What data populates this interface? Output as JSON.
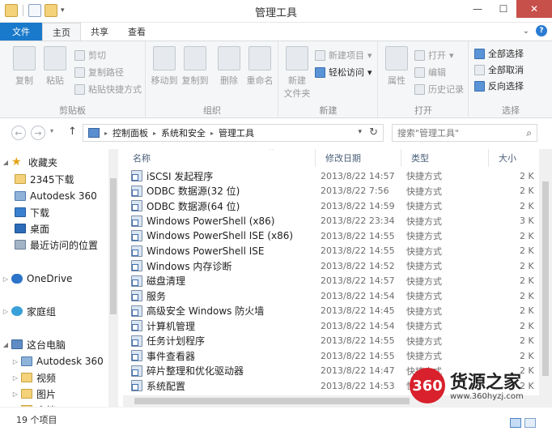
{
  "window": {
    "title": "管理工具",
    "controls": {
      "minimize": "—",
      "maximize": "☐",
      "close": "✕"
    }
  },
  "ribbon_tabs": [
    "文件",
    "主页",
    "共享",
    "查看"
  ],
  "ribbon": {
    "clipboard": {
      "copy": "复制",
      "paste": "粘贴",
      "cut": "剪切",
      "copy_path": "复制路径",
      "paste_shortcut": "粘贴快捷方式",
      "label": "剪贴板"
    },
    "organize": {
      "move_to": "移动到",
      "copy_to": "复制到",
      "delete": "删除",
      "rename": "重命名",
      "label": "组织"
    },
    "new": {
      "new_folder_line1": "新建",
      "new_folder_line2": "文件夹",
      "new_item": "新建项目",
      "easy_access": "轻松访问",
      "label": "新建"
    },
    "open": {
      "properties": "属性",
      "open": "打开",
      "edit": "编辑",
      "history": "历史记录",
      "label": "打开"
    },
    "select": {
      "select_all": "全部选择",
      "select_none": "全部取消",
      "invert": "反向选择",
      "label": "选择"
    }
  },
  "address": {
    "crumbs": [
      "控制面板",
      "系统和安全",
      "管理工具"
    ],
    "search_placeholder": "搜索\"管理工具\""
  },
  "nav": {
    "favorites": "收藏夹",
    "fav_items": [
      "2345下载",
      "Autodesk 360",
      "下载",
      "桌面",
      "最近访问的位置"
    ],
    "onedrive": "OneDrive",
    "homegroup": "家庭组",
    "thispc": "这台电脑",
    "pc_items": [
      "Autodesk 360",
      "视频",
      "图片",
      "文档"
    ]
  },
  "columns": {
    "name": "名称",
    "date": "修改日期",
    "type": "类型",
    "size": "大小"
  },
  "files": [
    {
      "name": "iSCSI 发起程序",
      "date": "2013/8/22 14:57",
      "type": "快捷方式",
      "size": "2 K"
    },
    {
      "name": "ODBC 数据源(32 位)",
      "date": "2013/8/22 7:56",
      "type": "快捷方式",
      "size": "2 K"
    },
    {
      "name": "ODBC 数据源(64 位)",
      "date": "2013/8/22 14:59",
      "type": "快捷方式",
      "size": "2 K"
    },
    {
      "name": "Windows PowerShell (x86)",
      "date": "2013/8/22 23:34",
      "type": "快捷方式",
      "size": "3 K"
    },
    {
      "name": "Windows PowerShell ISE (x86)",
      "date": "2013/8/22 14:55",
      "type": "快捷方式",
      "size": "2 K"
    },
    {
      "name": "Windows PowerShell ISE",
      "date": "2013/8/22 14:55",
      "type": "快捷方式",
      "size": "2 K"
    },
    {
      "name": "Windows 内存诊断",
      "date": "2013/8/22 14:52",
      "type": "快捷方式",
      "size": "2 K"
    },
    {
      "name": "磁盘清理",
      "date": "2013/8/22 14:57",
      "type": "快捷方式",
      "size": "2 K"
    },
    {
      "name": "服务",
      "date": "2013/8/22 14:54",
      "type": "快捷方式",
      "size": "2 K"
    },
    {
      "name": "高级安全 Windows 防火墙",
      "date": "2013/8/22 14:45",
      "type": "快捷方式",
      "size": "2 K"
    },
    {
      "name": "计算机管理",
      "date": "2013/8/22 14:54",
      "type": "快捷方式",
      "size": "2 K"
    },
    {
      "name": "任务计划程序",
      "date": "2013/8/22 14:55",
      "type": "快捷方式",
      "size": "2 K"
    },
    {
      "name": "事件查看器",
      "date": "2013/8/22 14:55",
      "type": "快捷方式",
      "size": "2 K"
    },
    {
      "name": "碎片整理和优化驱动器",
      "date": "2013/8/22 14:47",
      "type": "快捷方式",
      "size": "2 K"
    },
    {
      "name": "系统配置",
      "date": "2013/8/22 14:53",
      "type": "快捷方式",
      "size": "2 K"
    }
  ],
  "status": {
    "count": "19 个项目"
  },
  "watermark": {
    "logo": "360",
    "brand": "货源之家",
    "url": "www.360hyzj.com"
  },
  "colors": {
    "file_tab": "#1979ca",
    "accent": "#1979ca",
    "close": "#c7504b",
    "ribbon_bg": "#f5f6f7"
  }
}
